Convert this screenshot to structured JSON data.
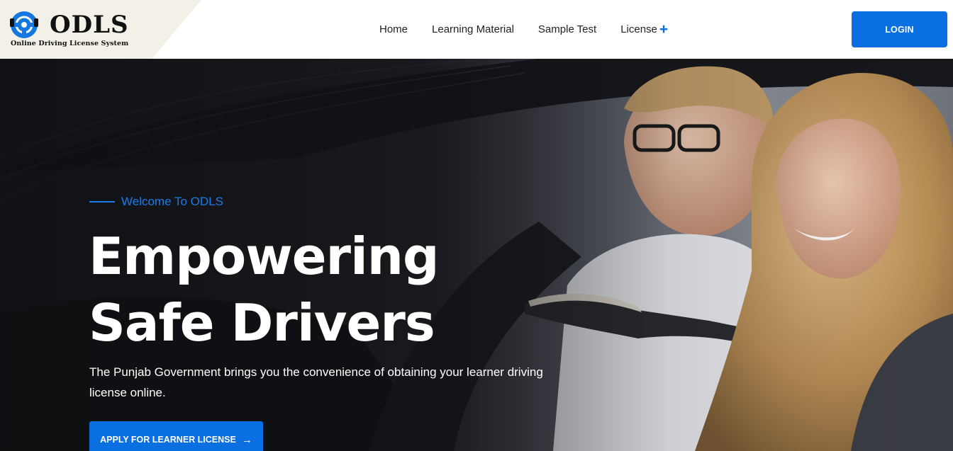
{
  "header": {
    "logo_title": "ODLS",
    "logo_subtitle": "Online Driving License System",
    "nav": [
      {
        "label": "Home"
      },
      {
        "label": "Learning Material"
      },
      {
        "label": "Sample Test"
      },
      {
        "label": "License",
        "icon": "plus-icon",
        "icon_glyph": "+"
      }
    ],
    "login_label": "LOGIN"
  },
  "hero": {
    "welcome": "Welcome To ODLS",
    "headline_line1": "Empowering",
    "headline_line2": "Safe Drivers",
    "description": "The Punjab Government brings you the convenience of obtaining your learner driving license online.",
    "apply_label": "APPLY FOR LEARNER LICENSE",
    "apply_icon": "arrow-right-icon",
    "apply_icon_glyph": "→"
  },
  "colors": {
    "accent": "#0a6fe0",
    "logo_plate": "#f3f0e8",
    "hero_overlay": "#1c1d22"
  }
}
